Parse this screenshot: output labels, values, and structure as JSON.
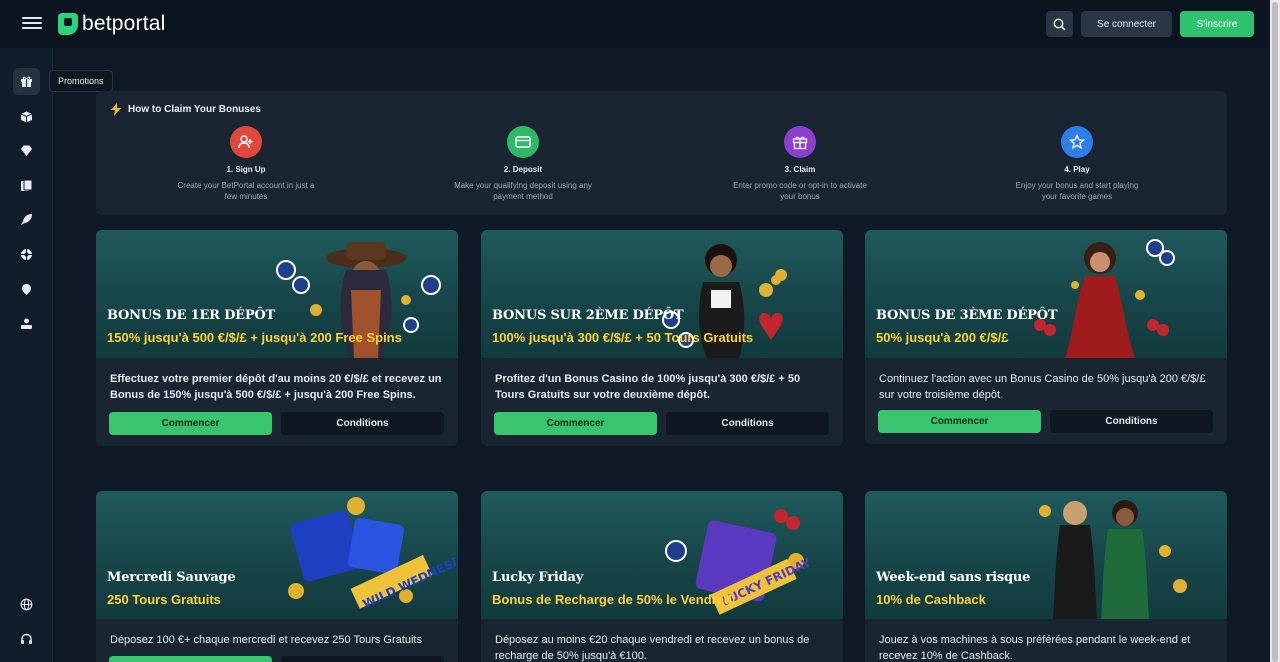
{
  "header": {
    "logo_text": "betportal",
    "login_label": "Se connecter",
    "signup_label": "S'inscrire"
  },
  "sidebar": {
    "tooltip": "Promotions",
    "items": [
      "gift-icon",
      "box-icon",
      "gem-icon",
      "cards-icon",
      "rocket-icon",
      "roulette-icon",
      "pin-icon",
      "dealer-icon",
      "globe-icon",
      "headset-icon"
    ]
  },
  "howto": {
    "title": "How to Claim Your Bonuses",
    "steps": [
      {
        "title": "1. Sign Up",
        "desc": "Create your BetPortal account in just a few minutes",
        "color": "#e2473d"
      },
      {
        "title": "2. Deposit",
        "desc": "Make your qualifying deposit using any payment method",
        "color": "#2fb866"
      },
      {
        "title": "3. Claim",
        "desc": "Enter promo code or opt-in to activate your bonus",
        "color": "#8a3fd1"
      },
      {
        "title": "4. Play",
        "desc": "Enjoy your bonus and start playing your favorite games",
        "color": "#2f7ee8"
      }
    ]
  },
  "cards": [
    {
      "title": "BONUS DE 1ER DÉPÔT",
      "subtitle": "150% jusqu'à 500 €/$/£ + jusqu'à 200 Free Spins",
      "text": "Effectuez votre premier dépôt d'au moins 20 €/$/£ et recevez un Bonus de 150% jusqu'à 500 €/$/£ + jusqu'à 200 Free Spins.",
      "start_label": "Commencer",
      "conditions_label": "Conditions"
    },
    {
      "title": "BONUS SUR 2ÈME DÉPÔT",
      "subtitle": "100% jusqu'à 300 €/$/£ + 50 Tours Gratuits",
      "text": "Profitez d'un Bonus Casino de 100% jusqu'à 300 €/$/£ + 50 Tours Gratuits sur votre deuxième dépôt.",
      "start_label": "Commencer",
      "conditions_label": "Conditions"
    },
    {
      "title": "BONUS DE 3ÈME DÉPÔT",
      "subtitle": "50% jusqu'à 200 €/$/£",
      "text": "Continuez l'action avec un Bonus Casino de 50% jusqu'à 200 €/$/£ sur votre troisième dépôt.",
      "start_label": "Commencer",
      "conditions_label": "Conditions"
    },
    {
      "title": "Mercredi Sauvage",
      "subtitle": "250 Tours Gratuits",
      "text": "Déposez 100 €+ chaque mercredi et recevez 250 Tours Gratuits",
      "art_text": "WILD WEDNESDAY"
    },
    {
      "title": "Lucky Friday",
      "subtitle": "Bonus de Recharge de 50% le Vendredi",
      "text": "Déposez au moins €20 chaque vendredi et recevez un bonus de recharge de 50% jusqu'à €100.",
      "art_text": "LUCKY FRIDAY"
    },
    {
      "title": "Week-end sans risque",
      "subtitle": "10% de Cashback",
      "text": "Jouez à vos machines à sous préférées pendant le week-end et recevez 10% de Cashback."
    }
  ],
  "colors": {
    "accent_green": "#39c46e",
    "gold": "#ffd23a",
    "panel": "#1a2532",
    "background": "#0f1a26"
  }
}
